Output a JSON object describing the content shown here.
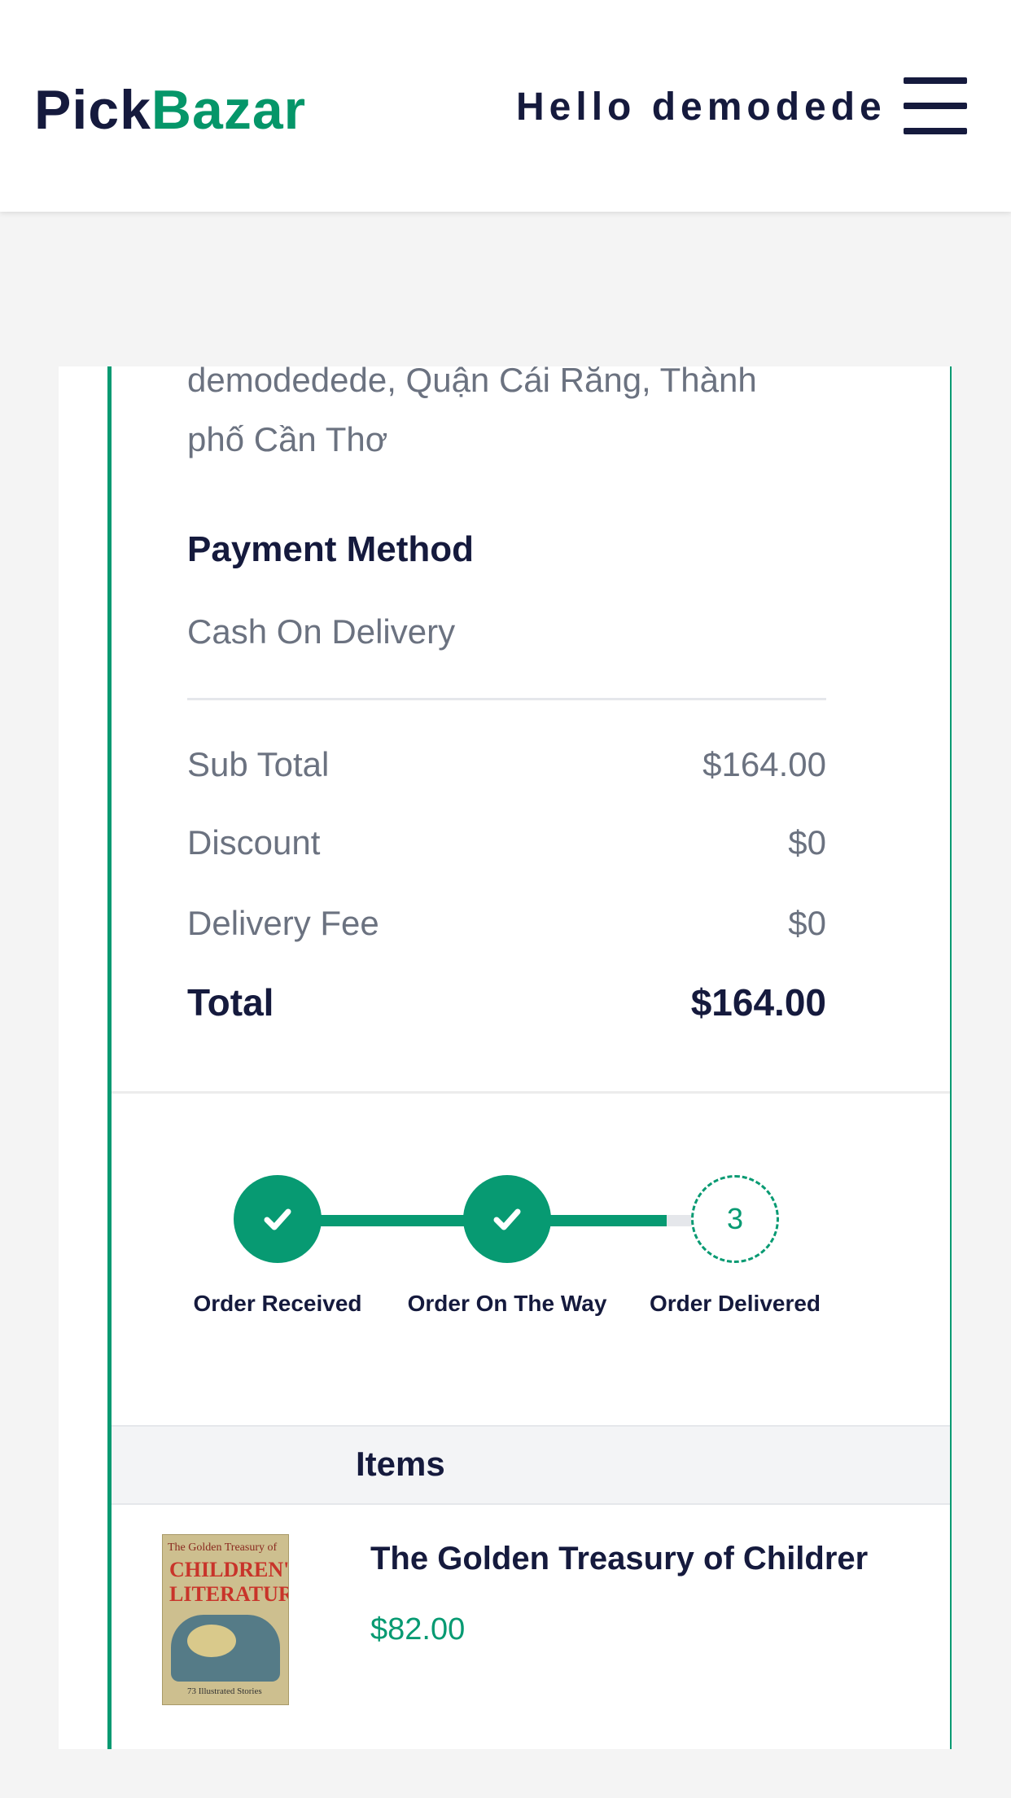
{
  "header": {
    "logo": {
      "part1": "Pick",
      "part2": "Bazar"
    },
    "greeting": "Hello demodede",
    "menu_icon": "hamburger-icon"
  },
  "order": {
    "address_lines": [
      "demodedede, Quận Cái Răng, Thành",
      "phố Cần Thơ"
    ],
    "payment": {
      "title": "Payment Method",
      "value": "Cash On Delivery"
    },
    "summary": {
      "subtotal": {
        "label": "Sub Total",
        "value": "$164.00"
      },
      "discount": {
        "label": "Discount",
        "value": "$0"
      },
      "delivery": {
        "label": "Delivery Fee",
        "value": "$0"
      },
      "total": {
        "label": "Total",
        "value": "$164.00"
      }
    },
    "tracking": {
      "steps": [
        {
          "label": "Order Received",
          "status": "done",
          "icon": "check-icon"
        },
        {
          "label": "Order On The Way",
          "status": "done",
          "icon": "check-icon"
        },
        {
          "label": "Order Delivered",
          "status": "pending",
          "number": "3"
        }
      ]
    },
    "items": {
      "header": "Items",
      "list": [
        {
          "name": "The Golden Treasury of Childrer",
          "price": "$82.00",
          "cover": {
            "top": "The Golden Treasury of",
            "line1": "CHILDREN'S",
            "line2": "LITERATURE",
            "sub": "73 Illustrated Stories"
          }
        }
      ]
    }
  },
  "colors": {
    "accent": "#079a72",
    "dark": "#151a3d",
    "muted": "#6b7280"
  }
}
